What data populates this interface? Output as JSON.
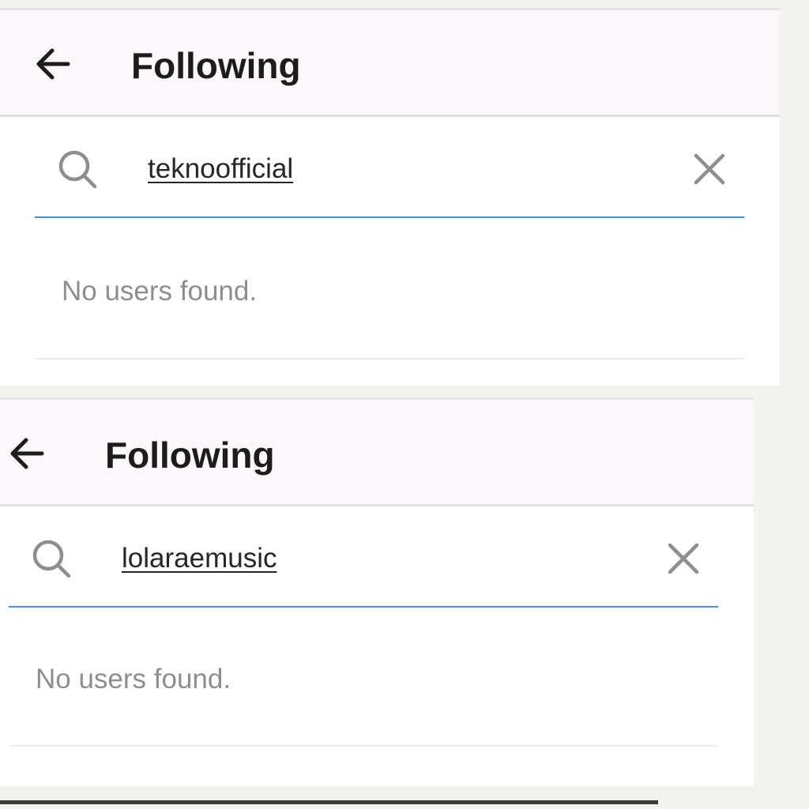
{
  "screens": [
    {
      "header": {
        "title": "Following",
        "back_icon": "arrow-left-icon"
      },
      "search": {
        "value": "teknoofficial",
        "search_icon": "search-icon",
        "clear_icon": "close-icon"
      },
      "results": {
        "empty_message": "No users found."
      }
    },
    {
      "header": {
        "title": "Following",
        "back_icon": "arrow-left-icon"
      },
      "search": {
        "value": "lolaraemusic",
        "search_icon": "search-icon",
        "clear_icon": "close-icon"
      },
      "results": {
        "empty_message": "No users found."
      }
    }
  ],
  "colors": {
    "header_background": "#fcf7fb",
    "search_underline": "#4a90d9",
    "muted_text": "#8e8e8e"
  }
}
